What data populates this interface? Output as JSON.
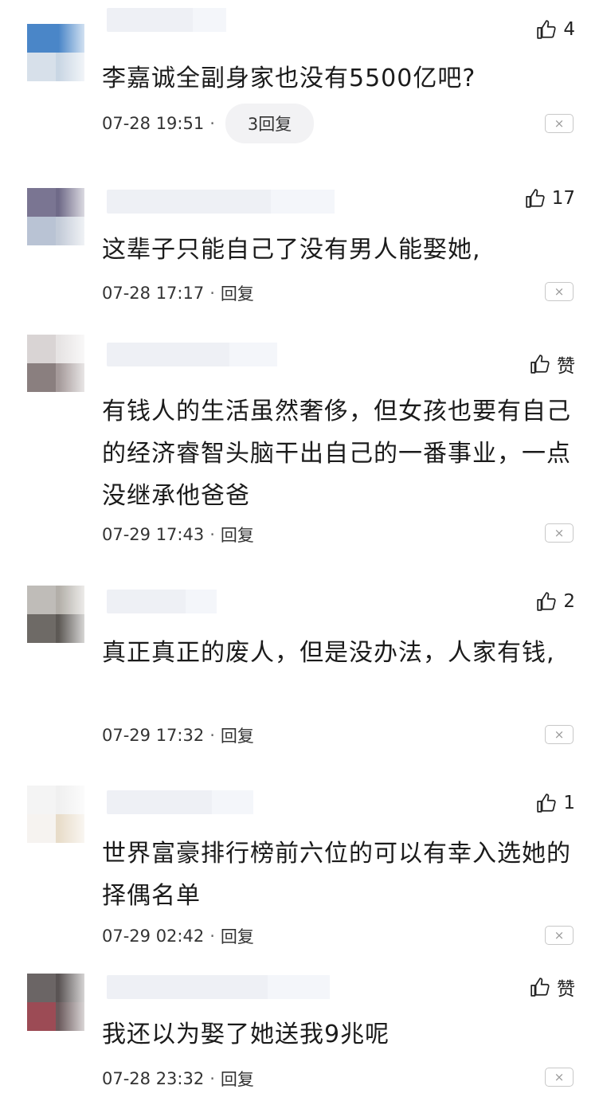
{
  "comments": [
    {
      "likes": "4",
      "text": "李嘉诚全副身家也没有5500亿吧?",
      "time": "07-28 19:51",
      "dot": "·",
      "reply": "3回复",
      "close": "×",
      "avatar": [
        "#4a86c8",
        "#4a86c8",
        "#d7e0ea",
        "#c9d6e4"
      ]
    },
    {
      "likes": "17",
      "text": "这辈子只能自己了没有男人能娶她,",
      "time": "07-28 17:17",
      "dot": "·",
      "reply": "回复",
      "close": "×",
      "avatar": [
        "#7a7592",
        "#6f6a88",
        "#b9c3d4",
        "#c3cbd8"
      ]
    },
    {
      "likes": "赞",
      "text": "有钱人的生活虽然奢侈，但女孩也要有自己的经济睿智头脑干出自己的一番事业，一点没继承他爸爸",
      "time": "07-29 17:43",
      "dot": "·",
      "reply": "回复",
      "close": "×",
      "avatar": [
        "#d9d4d4",
        "#e6e3e3",
        "#8a7f7f",
        "#a59a9a"
      ]
    },
    {
      "likes": "2",
      "text": "真正真正的废人，但是没办法，人家有钱,",
      "time": "07-29 17:32",
      "dot": "·",
      "reply": "回复",
      "close": "×",
      "avatar": [
        "#bfbcb8",
        "#b3afa9",
        "#6e6a66",
        "#5d5955"
      ]
    },
    {
      "likes": "1",
      "text": "世界富豪排行榜前六位的可以有幸入选她的择偶名单",
      "time": "07-29 02:42",
      "dot": "·",
      "reply": "回复",
      "close": "×",
      "avatar": [
        "#f4f4f4",
        "#f0f0f0",
        "#f6f3f0",
        "#e8dcc9"
      ]
    },
    {
      "likes": "赞",
      "text": "我还以为娶了她送我9兆呢",
      "time": "07-28 23:32",
      "dot": "·",
      "reply": "回复",
      "close": "×",
      "avatar": [
        "#6b6565",
        "#5a5454",
        "#9c4b55",
        "#6b5a5c"
      ]
    }
  ]
}
